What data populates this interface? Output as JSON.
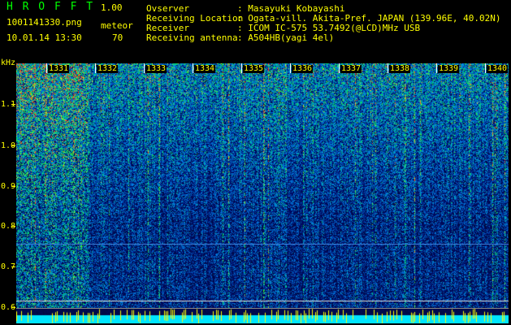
{
  "header": {
    "brand": "H R O F F T",
    "version": "1.00",
    "filename": "1001141330.png",
    "datetime": "10.01.14 13:30",
    "meteor_label": "meteor",
    "meteor_count": "70"
  },
  "station": {
    "observer_label": "Ovserver",
    "observer": ": Masayuki Kobayashi",
    "location_label": "Receiving Location",
    "location": ": Ogata-vill. Akita-Pref. JAPAN (139.96E, 40.02N)",
    "receiver_label": "Receiver",
    "receiver": ": ICOM IC-575 53.7492(@LCD)MHz USB",
    "antenna_label": "Receiving antenna",
    "antenna": ": A504HB(yagi 4el)"
  },
  "axis": {
    "unit": "kHz",
    "y_ticks": [
      "1.1",
      "1.0",
      "0.9",
      "0.8",
      "0.7",
      "0.6"
    ],
    "time_labels": [
      "1331",
      "1332",
      "1333",
      "1334",
      "1335",
      "1336",
      "1337",
      "1338",
      "1339",
      "1340"
    ]
  },
  "colors": {
    "text": "#ffff00",
    "brand": "#00ff00",
    "background": "#000000",
    "spectrum_low": "#001a66",
    "spectrum_high": "#ff3300",
    "bottom_band": "#00e5ff"
  }
}
